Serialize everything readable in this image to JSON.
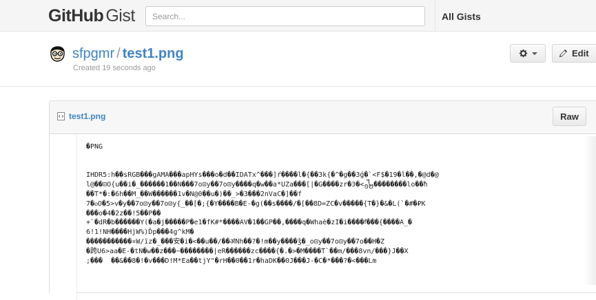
{
  "header": {
    "logo_github": "GitHub",
    "logo_gist": "Gist",
    "search_placeholder": "Search...",
    "all_gists": "All Gists"
  },
  "gist": {
    "owner": "sfpgmr",
    "separator": "/",
    "name": "test1.png",
    "created": "Created 19 seconds ago",
    "edit_label": "Edit",
    "settings_icon": "gear-icon",
    "edit_icon": "pencil-icon"
  },
  "file": {
    "name": "test1.png",
    "raw_label": "Raw",
    "lines": [
      "�PNG",
      "",
      "",
      "IHDR5:h��sRGB���gAMA���apHYs���o�d��IDATx^���]ŕ����l�{��3k{�^�g��3ǵ�`<F$�19�l��,�@d�@",
      "l@��⊡O{u��i�_������1��N���7o⊡y��7o⊡y����q�w��a*UZa���[|�G����zr�Ͽ�<᧼��������lo��ħ",
      "��T*�:�6h��M_��W������1v�N@0��u�)��_>�3���2nVaC�]��f",
      "7�ⲟO�5>v�y��7o⊡y��7o⊡y{_��[�;{�Y����B�E-�g(��s����/�[��8D=ZC�v�����{T�}�&�L(`�#�₽K",
      "���o�4�2z��!5��P��",
      "+`�dR�b������Y(�a�j�����P�e1�fK#*����AV�1��GP��,����q�Whaè�zI�i����ꬵ���{����A_�",
      "6!1!NH����HjW%)Ďp���4g^kM�",
      "�����������¤W/ïz�_���安�i�<��u��/��ॳNh��?�!m��y����ǯ�_o⊡y��7o⊡y��7o��H�Z",
      "�跨U6>aa�E-�tN�w��z���~��������|eR������zc����{�.�>�M����T`��m/���8vn/���}J��X",
      ";���  ��&��8�!�v���D!M*Ea��tjY\"�rH��0��1r�haDK��0J���J-�C�*���?�<���Lm"
    ]
  }
}
